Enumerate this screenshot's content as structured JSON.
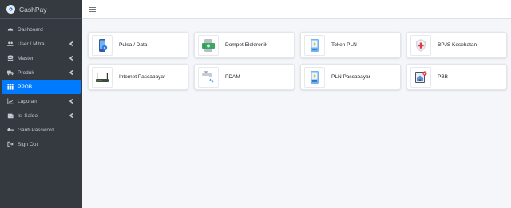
{
  "app": {
    "name": "CashPay"
  },
  "sidebar": {
    "items": [
      {
        "label": "Dashboard",
        "icon": "dashboard-icon",
        "has_submenu": false,
        "active": false
      },
      {
        "label": "User / Mitra",
        "icon": "users-icon",
        "has_submenu": true,
        "active": false
      },
      {
        "label": "Master",
        "icon": "database-icon",
        "has_submenu": true,
        "active": false
      },
      {
        "label": "Produk",
        "icon": "truck-icon",
        "has_submenu": true,
        "active": false
      },
      {
        "label": "PPOB",
        "icon": "grid-icon",
        "has_submenu": false,
        "active": true
      },
      {
        "label": "Laporan",
        "icon": "chart-icon",
        "has_submenu": true,
        "active": false
      },
      {
        "label": "Isi Saldo",
        "icon": "wallet-icon",
        "has_submenu": true,
        "active": false
      },
      {
        "label": "Ganti Password",
        "icon": "key-icon",
        "has_submenu": false,
        "active": false
      },
      {
        "label": "Sign Out",
        "icon": "sign-out-icon",
        "has_submenu": false,
        "active": false
      }
    ]
  },
  "header": {
    "menu_icon": "hamburger-icon"
  },
  "services": [
    {
      "label": "Pulsa / Data",
      "icon": "phone-icon"
    },
    {
      "label": "Dompet Elektronik",
      "icon": "e-wallet-icon"
    },
    {
      "label": "Token PLN",
      "icon": "electric-token-icon"
    },
    {
      "label": "BPJS Kesehatan",
      "icon": "health-shield-icon"
    },
    {
      "label": "Internet Pascabayar",
      "icon": "router-icon"
    },
    {
      "label": "PDAM",
      "icon": "water-tap-icon"
    },
    {
      "label": "PLN Pascabayar",
      "icon": "electric-bill-icon"
    },
    {
      "label": "PBB",
      "icon": "property-tax-icon"
    }
  ],
  "colors": {
    "sidebar_bg": "#343a40",
    "active": "#007bff",
    "content_bg": "#f4f6f9"
  }
}
